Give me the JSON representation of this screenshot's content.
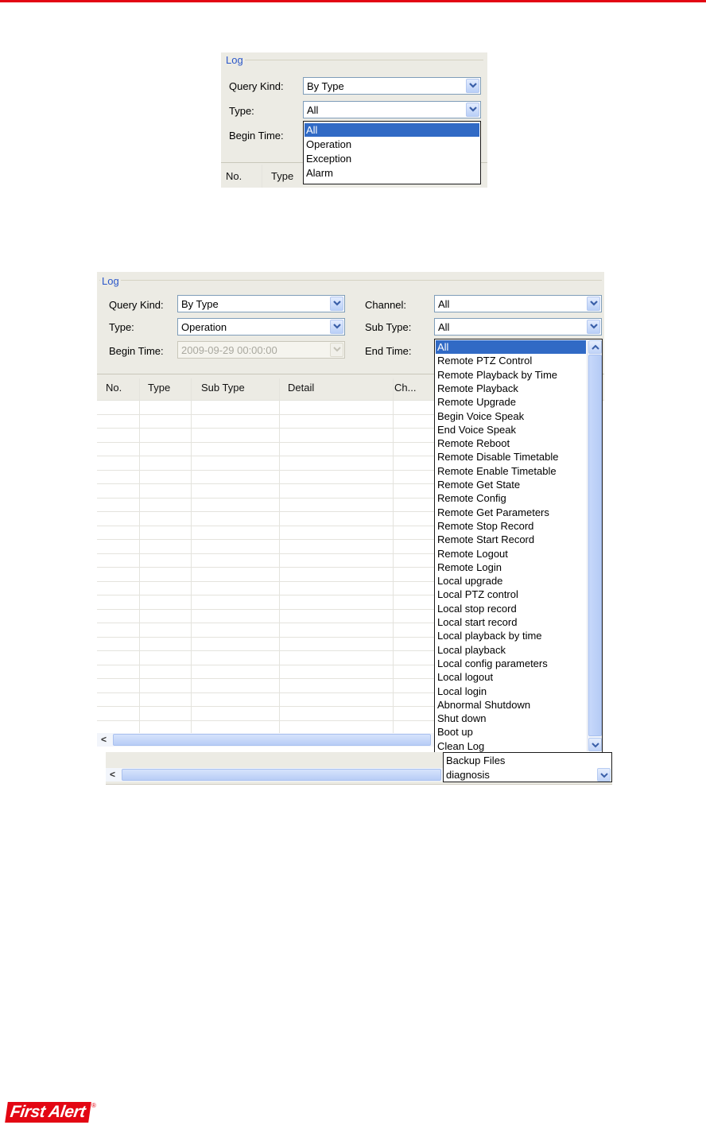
{
  "figure1": {
    "group_title": "Log",
    "query_kind": {
      "label": "Query Kind:",
      "value": "By Type"
    },
    "type": {
      "label": "Type:",
      "value": "All"
    },
    "begin_time": {
      "label": "Begin Time:"
    },
    "type_options": [
      "All",
      "Operation",
      "Exception",
      "Alarm"
    ],
    "table_headers": [
      "No.",
      "Type"
    ]
  },
  "figure2": {
    "group_title": "Log",
    "query_kind": {
      "label": "Query Kind:",
      "value": "By Type"
    },
    "type": {
      "label": "Type:",
      "value": "Operation"
    },
    "begin_time": {
      "label": "Begin Time:",
      "value": "2009-09-29 00:00:00"
    },
    "channel": {
      "label": "Channel:",
      "value": "All"
    },
    "sub_type": {
      "label": "Sub Type:",
      "value": "All"
    },
    "end_time": {
      "label": "End Time:"
    },
    "table_headers": [
      "No.",
      "Type",
      "Sub Type",
      "Detail",
      "Ch..."
    ],
    "sub_type_options": [
      "All",
      "Remote PTZ Control",
      "Remote Playback by Time",
      "Remote Playback",
      "Remote Upgrade",
      "Begin Voice Speak",
      "End Voice Speak",
      "Remote Reboot",
      "Remote Disable Timetable",
      "Remote Enable Timetable",
      "Remote Get State",
      "Remote Config",
      "Remote Get Parameters",
      "Remote Stop Record",
      "Remote Start Record",
      "Remote Logout",
      "Remote Login",
      "Local upgrade",
      "Local PTZ control",
      "Local stop record",
      "Local start record",
      "Local playback by time",
      "Local playback",
      "Local config parameters",
      "Local logout",
      "Local login",
      "Abnormal Shutdown",
      "Shut down",
      "Boot up",
      "Clean Log"
    ],
    "extra_options": [
      "Backup Files",
      "diagnosis"
    ]
  },
  "brand": {
    "name": "First Alert",
    "registered": "®",
    "accent": "#e30613"
  },
  "colors": {
    "selection": "#316ac5",
    "group_title": "#2b57c9",
    "panel": "#ecebe4"
  }
}
